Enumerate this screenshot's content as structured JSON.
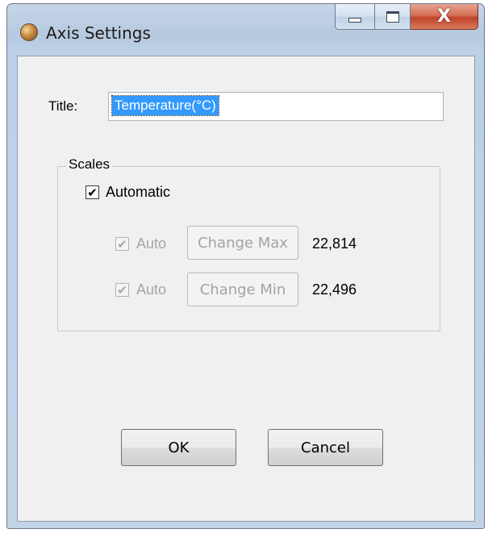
{
  "window": {
    "title": "Axis Settings",
    "caption": {
      "minimize_icon": "minimize-icon",
      "maximize_icon": "maximize-icon",
      "close_glyph": "X"
    }
  },
  "form": {
    "title_label": "Title:",
    "title_value": "Temperature(°C)"
  },
  "scales": {
    "group_label": "Scales",
    "automatic": {
      "label": "Automatic",
      "checked": true,
      "mark": "✔"
    },
    "max": {
      "auto_label": "Auto",
      "auto_checked": true,
      "mark": "✔",
      "button_label": "Change Max",
      "value": "22,814"
    },
    "min": {
      "auto_label": "Auto",
      "auto_checked": true,
      "mark": "✔",
      "button_label": "Change Min",
      "value": "22,496"
    }
  },
  "buttons": {
    "ok": "OK",
    "cancel": "Cancel"
  },
  "colors": {
    "selection": "#3399ff",
    "close_button": "#c0442a",
    "dialog_background": "#f0f0f0"
  }
}
